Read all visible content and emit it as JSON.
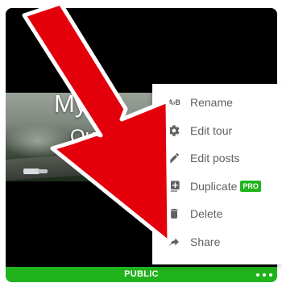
{
  "card": {
    "title": "Mystic",
    "subtitle": "Qu",
    "status_label": "PUBLIC",
    "status_color": "#21b31c"
  },
  "menu": {
    "items": [
      {
        "label": "Rename",
        "icon": "rename-icon",
        "icon_text": "A›B"
      },
      {
        "label": "Edit tour",
        "icon": "gear-icon"
      },
      {
        "label": "Edit posts",
        "icon": "pencil-icon"
      },
      {
        "label": "Duplicate",
        "icon": "duplicate-icon",
        "badge": "PRO"
      },
      {
        "label": "Delete",
        "icon": "trash-icon"
      },
      {
        "label": "Share",
        "icon": "share-icon"
      }
    ]
  },
  "colors": {
    "arrow": "#e3000b",
    "menu_text": "#616161"
  }
}
